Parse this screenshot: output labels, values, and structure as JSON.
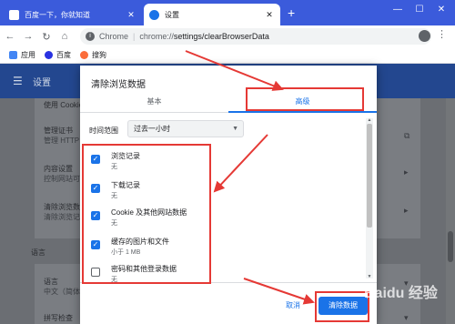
{
  "tabs": [
    {
      "title": "百度一下，你就知道",
      "active": false
    },
    {
      "title": "设置",
      "active": true
    }
  ],
  "toolbar": {
    "scheme_label": "Chrome",
    "url_host": "chrome://",
    "url_path": "settings/clearBrowserData"
  },
  "bookmarks": [
    {
      "label": "应用",
      "icon": "apps-grid-icon",
      "color": "#4285f4"
    },
    {
      "label": "百度",
      "icon": "baidu-paw-icon",
      "color": "#2932e1"
    },
    {
      "label": "搜狗",
      "icon": "sogou-icon",
      "color": "#fb6d3a"
    }
  ],
  "settings": {
    "header_title": "设置",
    "rows": [
      {
        "title": "使用 Cookie",
        "sub": ""
      },
      {
        "title": "管理证书",
        "sub": "管理 HTTP"
      },
      {
        "title": "内容设置",
        "sub": "控制网站可"
      },
      {
        "title": "清除浏览数",
        "sub": "清除浏览记"
      }
    ],
    "language_section": "语言",
    "language_row": {
      "title": "语言",
      "sub": "中文（简体"
    },
    "spell_row": {
      "title": "拼写检查"
    }
  },
  "dialog": {
    "title": "清除浏览数据",
    "tab_basic": "基本",
    "tab_advanced": "高级",
    "time_range_label": "时间范围",
    "time_range_value": "过去一小时",
    "options": [
      {
        "label": "浏览记录",
        "sub": "无",
        "checked": true
      },
      {
        "label": "下载记录",
        "sub": "无",
        "checked": true
      },
      {
        "label": "Cookie 及其他网站数据",
        "sub": "无",
        "checked": true
      },
      {
        "label": "缓存的图片和文件",
        "sub": "小于 1 MB",
        "checked": true
      },
      {
        "label": "密码和其他登录数据",
        "sub": "无",
        "checked": false
      }
    ],
    "cancel_label": "取消",
    "clear_label": "清除数据"
  },
  "colors": {
    "accent": "#1a73e8",
    "tabstrip": "#3b5bdb",
    "annotation": "#e53935"
  },
  "watermark": "Baidu 经验"
}
